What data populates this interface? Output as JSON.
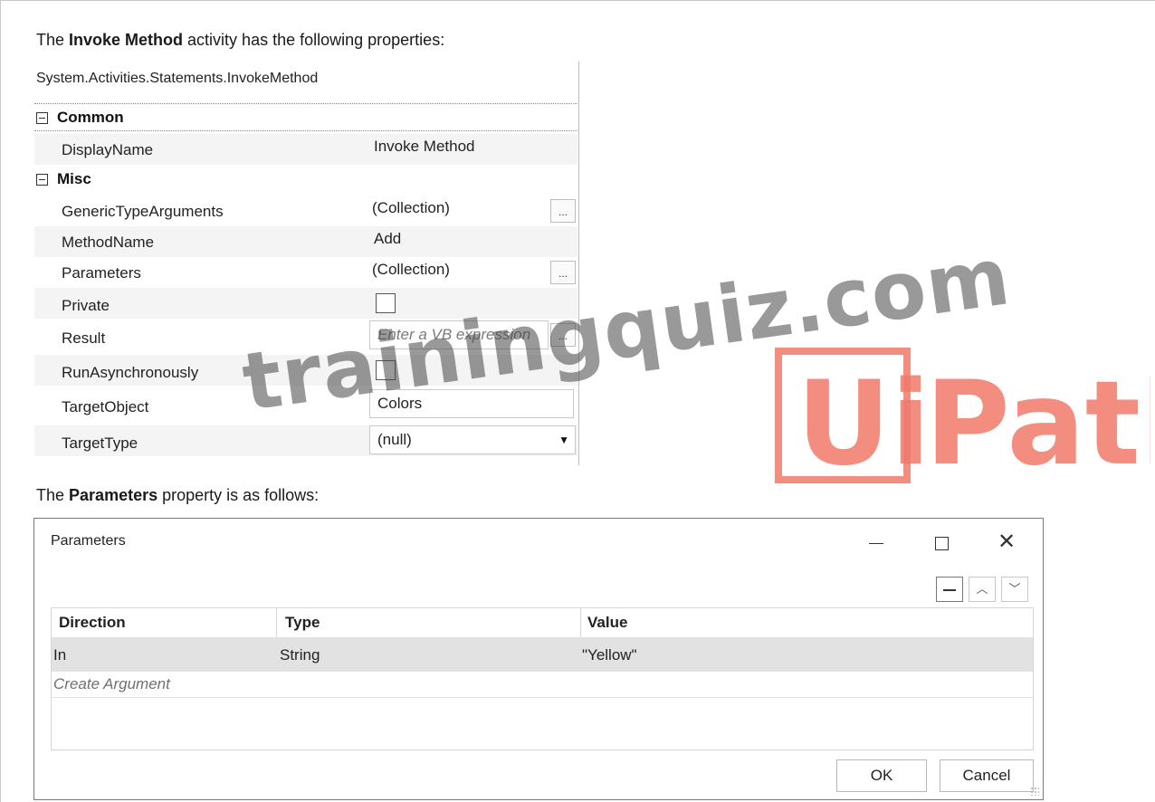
{
  "captions": {
    "intro_pre": "The ",
    "intro_bold": "Invoke Method",
    "intro_post": " activity has the following properties:",
    "params_pre": "The ",
    "params_bold": "Parameters",
    "params_post": " property is as follows:"
  },
  "property_grid": {
    "type_name": "System.Activities.Statements.InvokeMethod",
    "categories": {
      "common": "Common",
      "misc": "Misc"
    },
    "rows": {
      "display_name": {
        "label": "DisplayName",
        "value": "Invoke Method"
      },
      "generic_type_arguments": {
        "label": "GenericTypeArguments",
        "value": "(Collection)",
        "button": "..."
      },
      "method_name": {
        "label": "MethodName",
        "value": "Add"
      },
      "parameters": {
        "label": "Parameters",
        "value": "(Collection)",
        "button": "..."
      },
      "private": {
        "label": "Private",
        "checked": false
      },
      "result": {
        "label": "Result",
        "placeholder": "Enter a VB expression",
        "button": "..."
      },
      "run_async": {
        "label": "RunAsynchronously",
        "checked": false
      },
      "target_object": {
        "label": "TargetObject",
        "value": "Colors"
      },
      "target_type": {
        "label": "TargetType",
        "value": "(null)"
      }
    }
  },
  "parameters_dialog": {
    "title": "Parameters",
    "columns": [
      "Direction",
      "Type",
      "Value"
    ],
    "rows": [
      {
        "direction": "In",
        "type": "String",
        "value": "\"Yellow\""
      }
    ],
    "create_argument": "Create Argument",
    "ok_label": "OK",
    "cancel_label": "Cancel"
  },
  "watermarks": {
    "site": "trainingquiz.com",
    "logo_text": "UiPath",
    "logo_color": "#f07a6a"
  }
}
